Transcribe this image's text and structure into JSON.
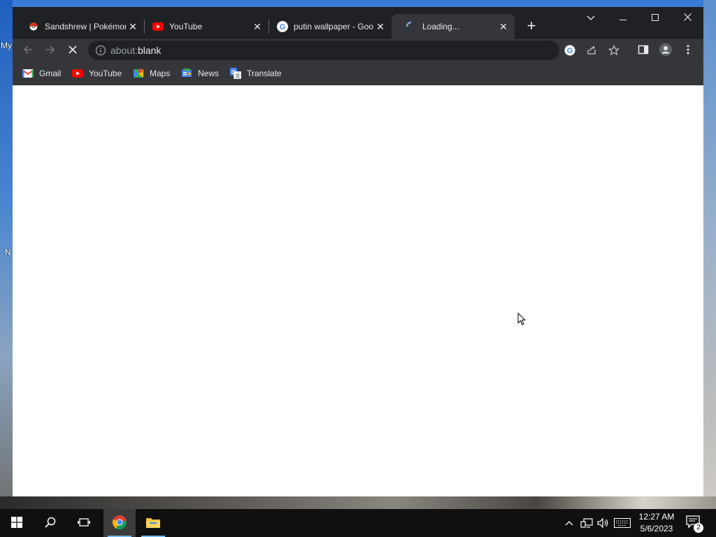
{
  "desktop": {
    "labels": [
      "My",
      "N"
    ]
  },
  "browser": {
    "tabs": [
      {
        "title": "Sandshrew | Pokémon",
        "icon": "pokeball-icon",
        "active": false
      },
      {
        "title": "YouTube",
        "icon": "youtube-icon",
        "active": false
      },
      {
        "title": "putin wallpaper - Google Search",
        "icon": "google-icon",
        "active": false
      },
      {
        "title": "Loading...",
        "icon": "loading-spinner-icon",
        "active": true
      }
    ],
    "new_tab_label": "+",
    "address": {
      "scheme": "about:",
      "host": "blank"
    },
    "bookmarks": [
      {
        "label": "Gmail",
        "icon": "gmail-icon"
      },
      {
        "label": "YouTube",
        "icon": "youtube-icon"
      },
      {
        "label": "Maps",
        "icon": "maps-icon"
      },
      {
        "label": "News",
        "icon": "news-icon"
      },
      {
        "label": "Translate",
        "icon": "translate-icon"
      }
    ]
  },
  "taskbar": {
    "time": "12:27 AM",
    "date": "5/6/2023",
    "notification_count": "2",
    "pinned": [
      {
        "name": "chrome",
        "icon": "chrome-icon",
        "active": true
      },
      {
        "name": "file-explorer",
        "icon": "folder-icon",
        "active": false
      }
    ]
  },
  "colors": {
    "tab_strip": "#202124",
    "toolbar": "#35363a",
    "taskbar": "#101010",
    "accent": "#76b9ed"
  }
}
